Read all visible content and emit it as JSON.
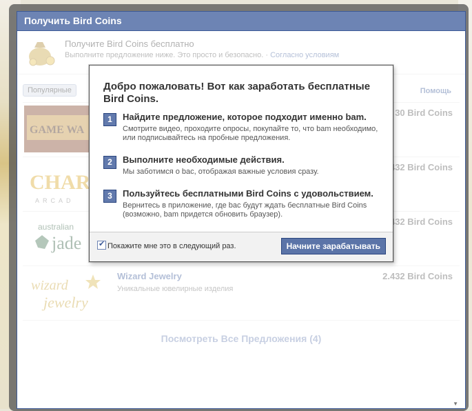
{
  "dialog": {
    "title": "Получить Bird Coins",
    "header_title": "Получите Bird Coins бесплатно",
    "header_subtitle": "Выполните предложение ниже. Это просто и безопасно.",
    "header_link_sep": " · ",
    "terms_link": "Согласно условиям",
    "tab_popular": "Популярные",
    "help_link": "Помощь",
    "see_all": "Посмотреть Все Предложения (4)",
    "offers": [
      {
        "name": "",
        "desc": "",
        "coins": "30 Bird Coins"
      },
      {
        "name": "",
        "desc": "",
        "coins": "2.432 Bird Coins"
      },
      {
        "name": "",
        "desc": "",
        "coins": "2.432 Bird Coins"
      },
      {
        "name": "Wizard Jewelry",
        "desc": "Уникальные ювелирные изделия",
        "coins": "2.432 Bird Coins"
      }
    ],
    "logos": {
      "game": "GAME WA",
      "charm": "CHAR",
      "charm_sub": "ARCAD",
      "jade_top": "australian",
      "jade": "jade",
      "wizard": "wizard",
      "jewelry": "jewelry"
    }
  },
  "modal": {
    "title": "Добро пожаловать! Вот как заработать бесплатные Bird Coins.",
    "steps": [
      {
        "num": "1",
        "title": "Найдите предложение, которое подходит именно bam.",
        "desc": "Смотрите видео, проходите опросы, покупайте то, что bam необходимо, или подписывайтесь на пробные предложения."
      },
      {
        "num": "2",
        "title": "Выполните необходимые действия.",
        "desc": "Мы заботимся о bac, отображая важные условия сразу."
      },
      {
        "num": "3",
        "title": "Пользуйтесь бесплатными Bird Coins с удовольствием.",
        "desc": "Вернитесь в приложение, где bac будут ждать бесплатные Bird Coins (возможно, bam придется обновить браузер)."
      }
    ],
    "checkbox_label": "Покажите мне это в следующий раз.",
    "checkbox_checked": true,
    "start_button": "Начните зарабатывать"
  },
  "colors": {
    "brand": "#3b5998",
    "title_bar": "#6d84b4",
    "button": "#5b74a8"
  }
}
